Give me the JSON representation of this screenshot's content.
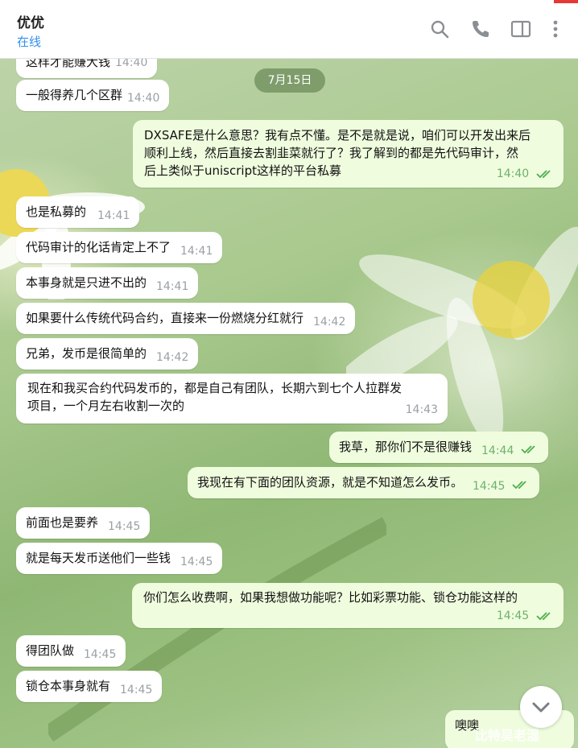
{
  "header": {
    "name": "优优",
    "status": "在线"
  },
  "date_chip": "7月15日",
  "messages": [
    {
      "text": "这样才能赚大钱",
      "time": "14:40"
    },
    {
      "text": "一般得养几个区群",
      "time": "14:40"
    },
    {
      "lines": [
        "DXSAFE是什么意思？我有点不懂。是不是就是说，咱们可以开发出来后",
        "顺利上线，然后直接去割韭菜就行了？我了解到的都是先代码审计，然",
        "后上类似于uniscript这样的平台私募"
      ],
      "time": "14:40"
    },
    {
      "text": "也是私募的",
      "time": "14:41"
    },
    {
      "text": "代码审计的化话肯定上不了",
      "time": "14:41"
    },
    {
      "text": "本事身就是只进不出的",
      "time": "14:41"
    },
    {
      "text": "如果要什么传统代码合约，直接来一份燃烧分红就行",
      "time": "14:42"
    },
    {
      "text": "兄弟，发币是很简单的",
      "time": "14:42"
    },
    {
      "lines": [
        "现在和我买合约代码发币的，都是自己有团队，长期六到七个人拉群发",
        "项目，一个月左右收割一次的"
      ],
      "time": "14:43"
    },
    {
      "text": "我草，那你们不是很赚钱",
      "time": "14:44"
    },
    {
      "text": "我现在有下面的团队资源，就是不知道怎么发币。",
      "time": "14:45"
    },
    {
      "text": "前面也是要养",
      "time": "14:45"
    },
    {
      "text": "就是每天发币送他们一些钱",
      "time": "14:45"
    },
    {
      "text": "你们怎么收费啊，如果我想做功能呢？比如彩票功能、锁仓功能这样的",
      "time": "14:45"
    },
    {
      "text": "得团队做",
      "time": "14:45"
    },
    {
      "text": "锁仓本事身就有",
      "time": "14:45"
    },
    {
      "text": "噢噢"
    }
  ],
  "watermark": "比特吴老湿",
  "colors": {
    "incoming": "#ffffff",
    "outgoing": "#effdde",
    "status_blue": "#3390ec",
    "tick_green": "#4fae4e"
  }
}
